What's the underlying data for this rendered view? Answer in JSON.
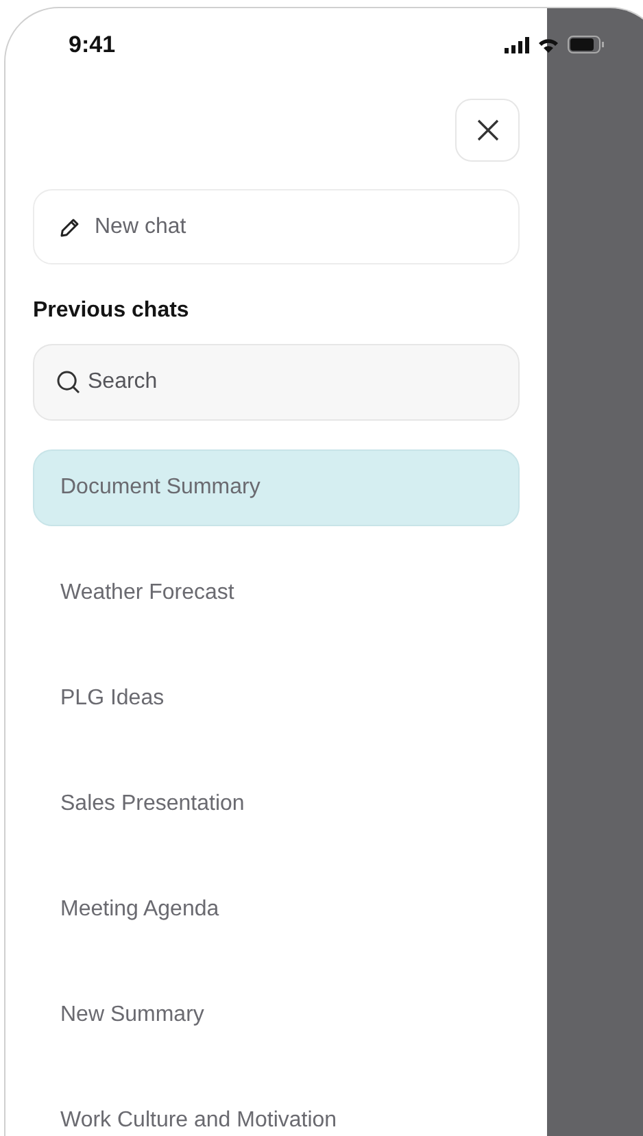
{
  "status_bar": {
    "time": "9:41"
  },
  "new_chat": {
    "label": "New chat"
  },
  "section_title": "Previous chats",
  "search": {
    "placeholder": "Search"
  },
  "chats": [
    {
      "title": "Document Summary",
      "selected": true
    },
    {
      "title": "Weather Forecast",
      "selected": false
    },
    {
      "title": "PLG Ideas",
      "selected": false
    },
    {
      "title": "Sales Presentation",
      "selected": false
    },
    {
      "title": "Meeting Agenda",
      "selected": false
    },
    {
      "title": "New Summary",
      "selected": false
    },
    {
      "title": "Work Culture and Motivation",
      "selected": false
    }
  ]
}
